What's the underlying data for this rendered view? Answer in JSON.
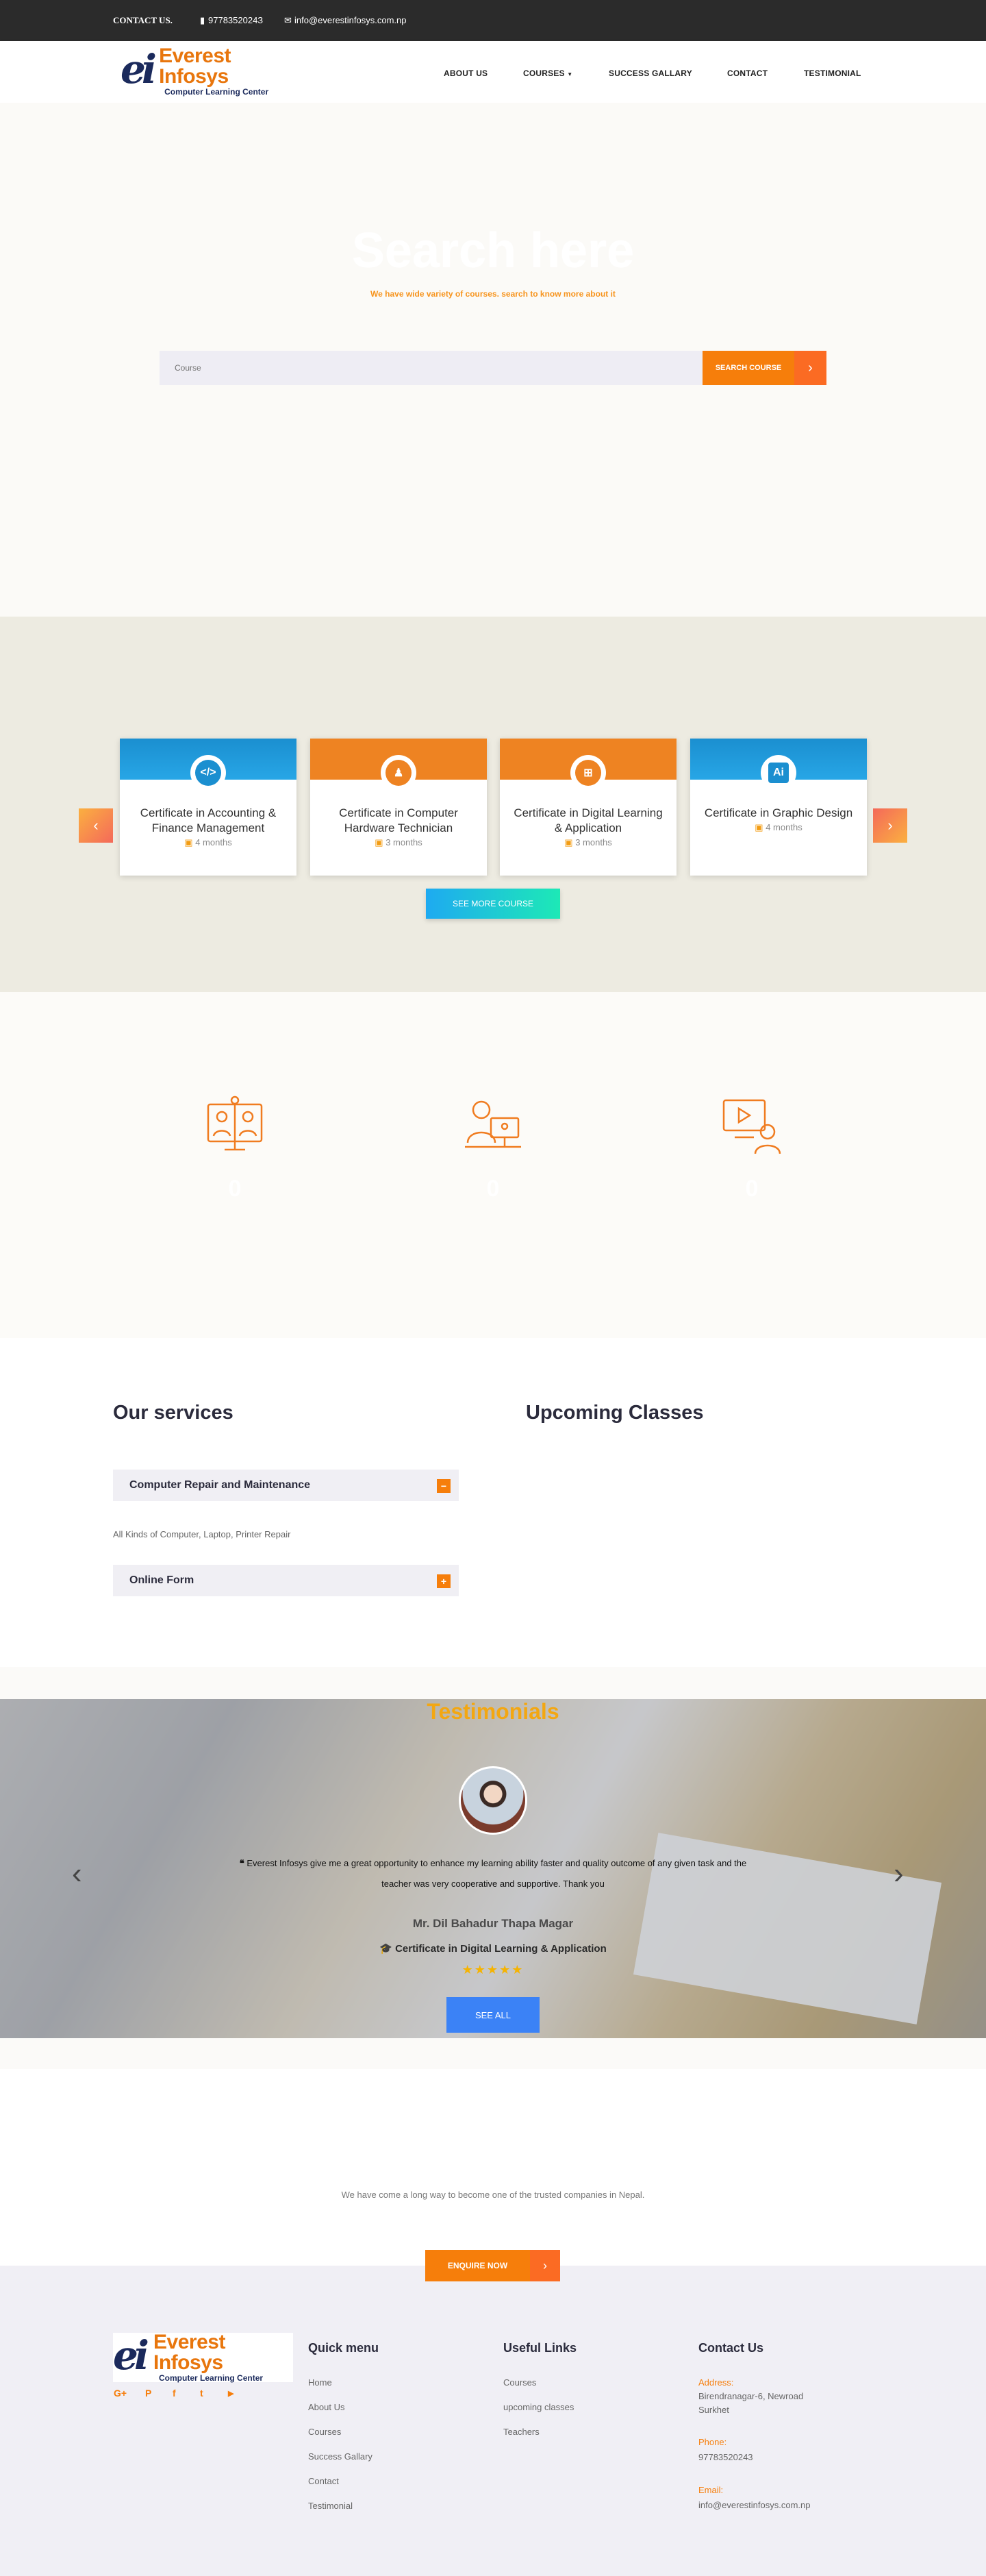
{
  "topbar": {
    "contact_label": "CONTACT US.",
    "phone": "9778352024З",
    "email": "info@everestinfosys.com.np"
  },
  "logo": {
    "mark": "ei",
    "brand": "Everest Infosys",
    "tagline": "Computer Learning Center"
  },
  "nav": {
    "items": [
      "ABOUT US",
      "COURSES",
      "SUCCESS GALLARY",
      "CONTACT",
      "TESTIMONIAL"
    ]
  },
  "hero": {
    "title": "Search here",
    "subtitle": "We have wide variety of courses. search to know more about it",
    "search_placeholder": "Course",
    "search_button": "SEARCH COURSE"
  },
  "courses": {
    "cards": [
      {
        "title": "Certificate in Accounting & Finance Management",
        "duration": "4 months",
        "color": "#1b8fd0",
        "icon": "code-icon"
      },
      {
        "title": "Certificate in Computer Hardware Technician",
        "duration": "3 months",
        "color": "#ee8322",
        "icon": "linux-icon"
      },
      {
        "title": "Certificate in Digital Learning & Application",
        "duration": "3 months",
        "color": "#ee8322",
        "icon": "windows-icon"
      },
      {
        "title": "Certificate in Graphic Design",
        "duration": "4 months",
        "color": "#1b8fd0",
        "icon": "illustrator-icon"
      }
    ],
    "see_more": "SEE MORE COURSE"
  },
  "features": {
    "numbers": [
      "0",
      "0",
      "0"
    ],
    "icons": [
      "online-class-icon",
      "student-computer-icon",
      "video-lesson-icon"
    ],
    "accent": "#f07c20"
  },
  "services": {
    "title": "Our services",
    "upcoming_title": "Upcoming Classes",
    "items": [
      {
        "label": "Computer Repair and Maintenance",
        "toggle": "−",
        "body": "All Kinds of Computer, Laptop, Printer Repair"
      },
      {
        "label": "Online Form",
        "toggle": "+"
      }
    ]
  },
  "testimonials": {
    "title": "Testimonials",
    "quote": "Everest Infosys give me a great opportunity to enhance my learning ability faster and quality outcome of any given task and the teacher was very cooperative and supportive. Thank you",
    "name": "Mr. Dil Bahadur Thapa Magar",
    "course": "Certificate in Digital Learning & Application",
    "stars": 5,
    "see_all": "SEE ALL"
  },
  "about": {
    "text": "We have come a long way to become one of the trusted companies in Nepal.",
    "enquire": "ENQUIRE NOW"
  },
  "footer": {
    "quick_menu_title": "Quick menu",
    "quick_menu": [
      "Home",
      "About Us",
      "Courses",
      "Success Gallary",
      "Contact",
      "Testimonial"
    ],
    "useful_title": "Useful Links",
    "useful": [
      "Courses",
      "upcoming classes",
      "Teachers"
    ],
    "contact_title": "Contact Us",
    "address_label": "Address:",
    "address_line1": "Birendranagar-6, Newroad",
    "address_line2": "Surkhet",
    "phone_label": "Phone:",
    "phone": "97783520243",
    "email_label": "Email:",
    "email": "info@everestinfosys.com.np",
    "social": [
      "G+",
      "P",
      "f",
      "t",
      "▶"
    ]
  }
}
